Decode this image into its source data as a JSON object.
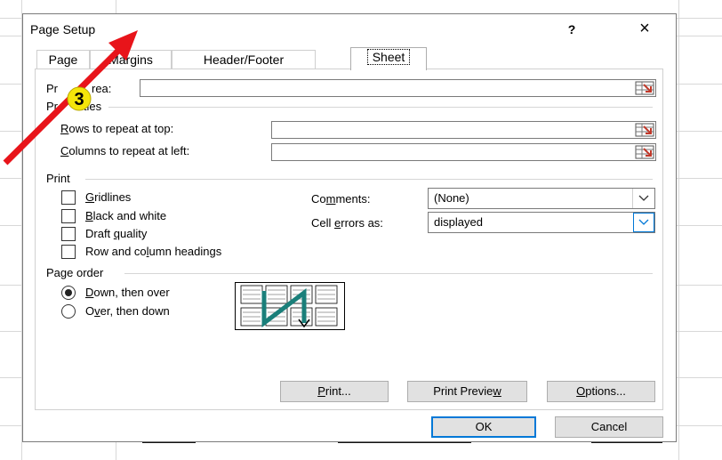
{
  "dialog": {
    "title": "Page Setup",
    "help_label": "?",
    "close_label": "×"
  },
  "tabs": [
    {
      "label": "Page",
      "active": false
    },
    {
      "label": "Margins",
      "active": false
    },
    {
      "label": "Header/Footer",
      "active": false
    },
    {
      "label": "Sheet",
      "active": true
    }
  ],
  "sheet": {
    "print_area": {
      "label_prefix": "Pr",
      "label_suffix": "rea:",
      "value": ""
    },
    "print_titles": {
      "section_prefix": "Pr",
      "section_suffix": "itles",
      "rows_label_key": "R",
      "rows_label_rest": "ows to repeat at top:",
      "rows_value": "",
      "cols_label_key": "C",
      "cols_label_rest": "olumns to repeat at left:",
      "cols_value": ""
    },
    "print": {
      "section": "Print",
      "gridlines_key": "G",
      "gridlines_rest": "ridlines",
      "gridlines_checked": false,
      "bw_key": "B",
      "bw_rest": "lack and white",
      "bw_checked": false,
      "draft_pre": "Draft ",
      "draft_key": "q",
      "draft_rest": "uality",
      "draft_checked": false,
      "headings_pre": "Row and co",
      "headings_key": "l",
      "headings_rest": "umn headings",
      "headings_checked": false,
      "comments_pre": "Co",
      "comments_key": "m",
      "comments_rest": "ments:",
      "comments_value": "(None)",
      "errors_pre": "Cell ",
      "errors_key": "e",
      "errors_rest": "rrors as:",
      "errors_value": "displayed"
    },
    "page_order": {
      "section": "Page order",
      "down_key": "D",
      "down_rest": "own, then over",
      "down_selected": true,
      "over_pre": "O",
      "over_key": "v",
      "over_rest": "er, then down",
      "over_selected": false
    }
  },
  "buttons": {
    "print_key": "P",
    "print_rest": "rint...",
    "preview_pre": "Print Previe",
    "preview_key": "w",
    "options_key": "O",
    "options_rest": "ptions...",
    "ok": "OK",
    "cancel": "Cancel"
  },
  "annotation": {
    "step_number": "3",
    "badge_color": "#f5e50a",
    "arrow_color": "#e8141a"
  },
  "colors": {
    "focus_blue": "#0078d7",
    "picker_red": "#c0392b"
  }
}
